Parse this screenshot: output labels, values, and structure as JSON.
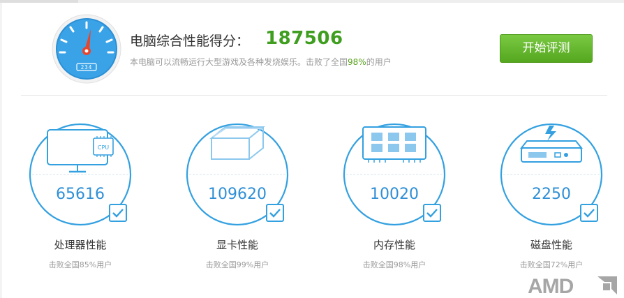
{
  "summary": {
    "title": "电脑综合性能得分：",
    "score": "187506",
    "desc_prefix": "本电脑可以流畅运行大型游戏及各种发烧娱乐。击败了全国",
    "desc_percent": "98%",
    "desc_suffix": "的用户",
    "gauge_readout": "234",
    "start_button": "开始评测"
  },
  "cards": [
    {
      "name": "处理器性能",
      "score": "65616",
      "rank": "击败全国85%用户",
      "icon": "cpu-monitor-icon",
      "chip_label": "CPU"
    },
    {
      "name": "显卡性能",
      "score": "109620",
      "rank": "击败全国99%用户",
      "icon": "gpu-cube-icon"
    },
    {
      "name": "内存性能",
      "score": "10020",
      "rank": "击败全国98%用户",
      "icon": "ram-module-icon"
    },
    {
      "name": "磁盘性能",
      "score": "2250",
      "rank": "击败全国72%用户",
      "icon": "disk-drive-icon"
    }
  ],
  "brand": {
    "name": "AMD"
  },
  "colors": {
    "accent_blue": "#2f8fd6",
    "score_green": "#3f9e1f",
    "button_green": "#6dbd36",
    "gauge_red": "#e8452c"
  }
}
